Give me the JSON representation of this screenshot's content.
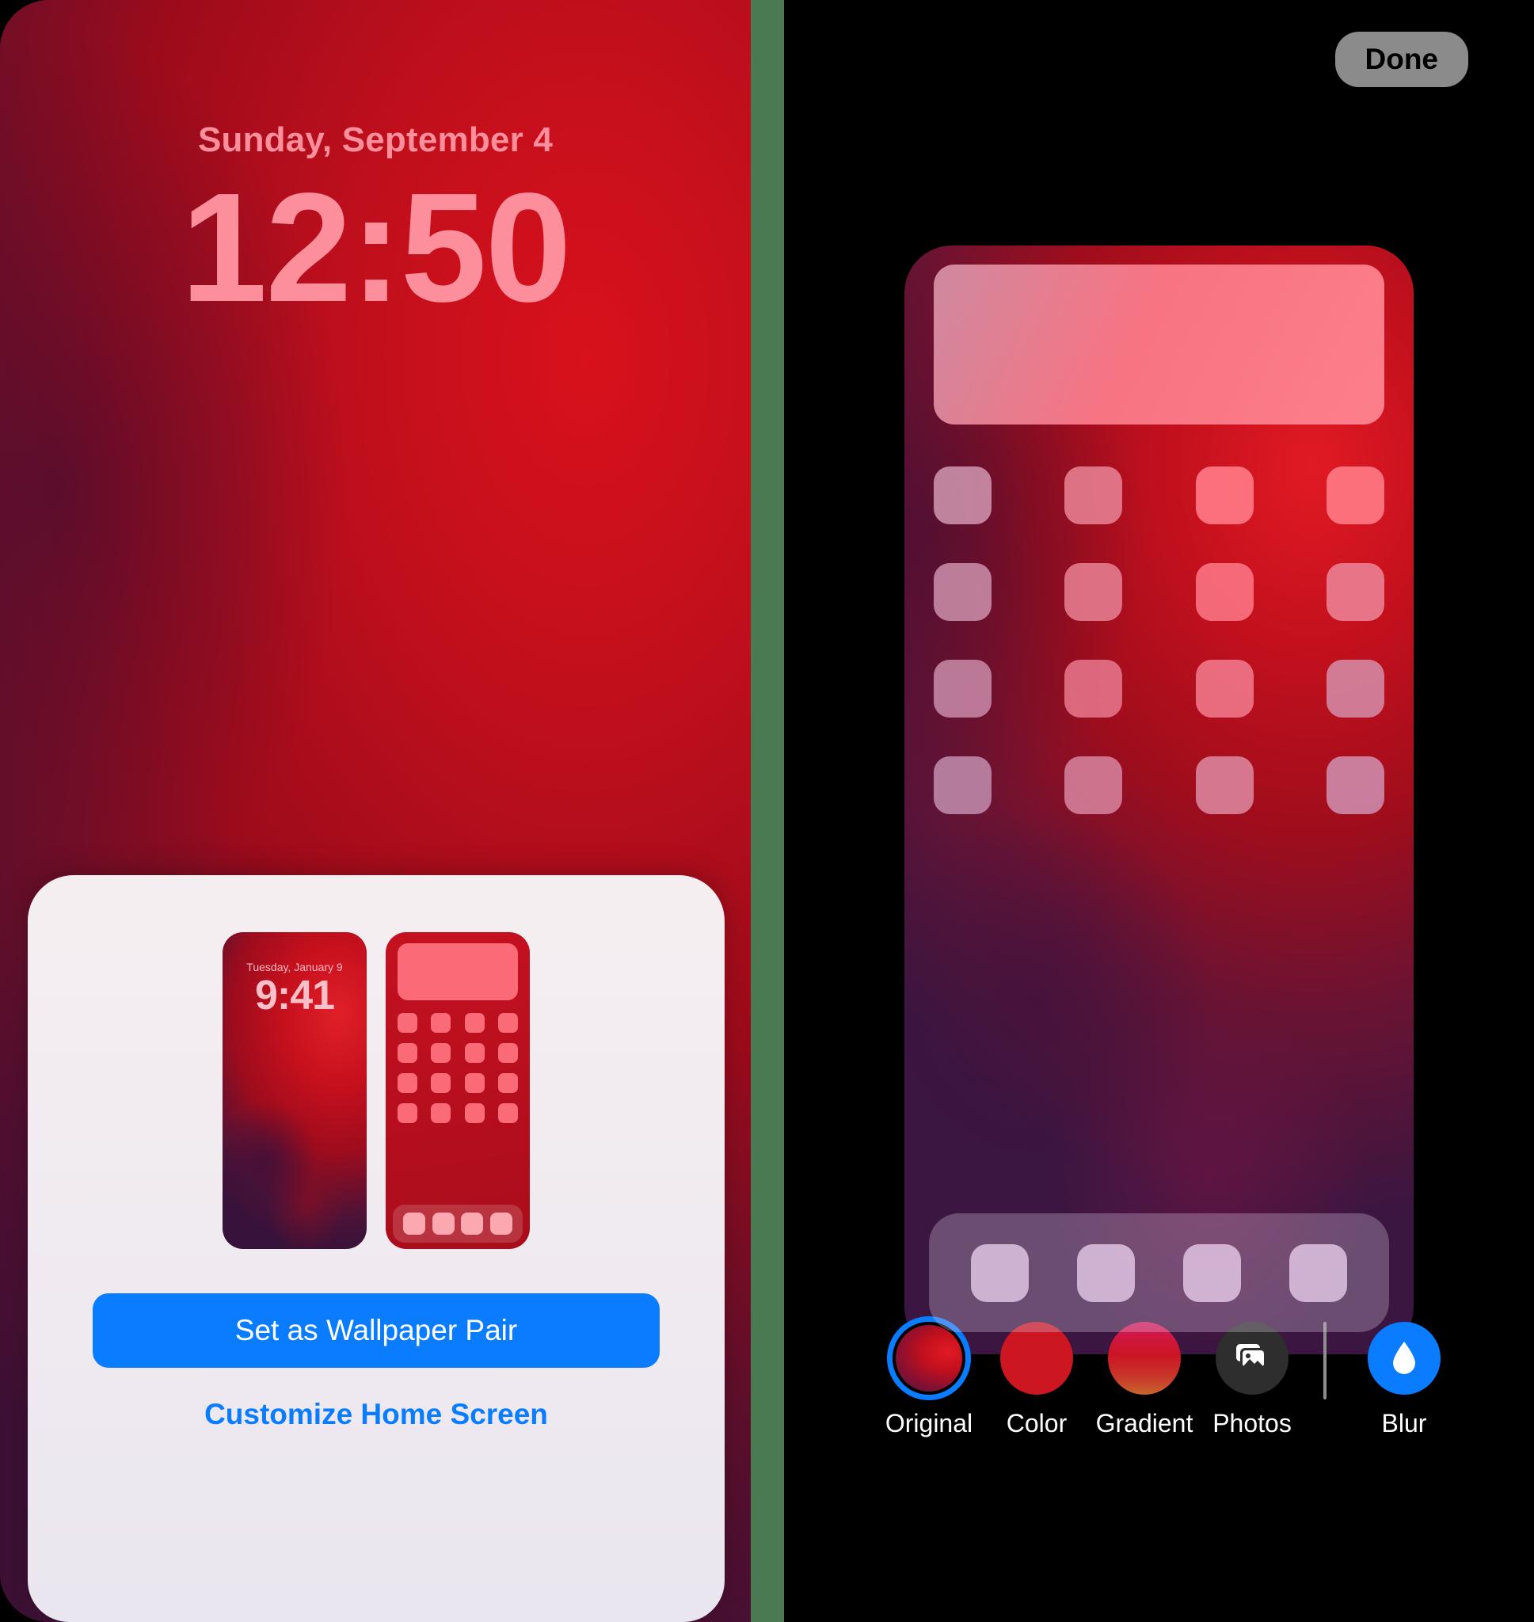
{
  "lock_screen": {
    "date": "Sunday, September 4",
    "time": "12:50",
    "text_color": "#fd8e9b"
  },
  "pair_card": {
    "lock_thumbnail": {
      "date": "Tuesday, January 9",
      "time": "9:41"
    },
    "home_thumbnail": {
      "widget": "large-widget-placeholder",
      "icon_rows": 4,
      "icon_columns": 4,
      "dock_icons": 4
    },
    "set_pair_label": "Set as Wallpaper Pair",
    "customize_home_label": "Customize Home Screen",
    "accent_color": "#0a7cff"
  },
  "editor": {
    "done_label": "Done",
    "phone_preview": {
      "widget": "large-widget-placeholder",
      "icon_rows": 4,
      "icon_columns": 4,
      "dock_icons": 4
    },
    "style_options": [
      {
        "label": "Original",
        "icon": "original-swatch-icon",
        "selected": true
      },
      {
        "label": "Color",
        "icon": "color-swatch-icon",
        "selected": false
      },
      {
        "label": "Gradient",
        "icon": "gradient-swatch-icon",
        "selected": false
      },
      {
        "label": "Photos",
        "icon": "photos-icon",
        "selected": false
      },
      {
        "label": "Blur",
        "icon": "water-drop-icon",
        "selected": false
      }
    ],
    "selected_style": "Original",
    "selection_ring_color": "#0a7cff",
    "blur_button_color": "#0a7cff",
    "photos_button_color": "#2e2e2e"
  }
}
